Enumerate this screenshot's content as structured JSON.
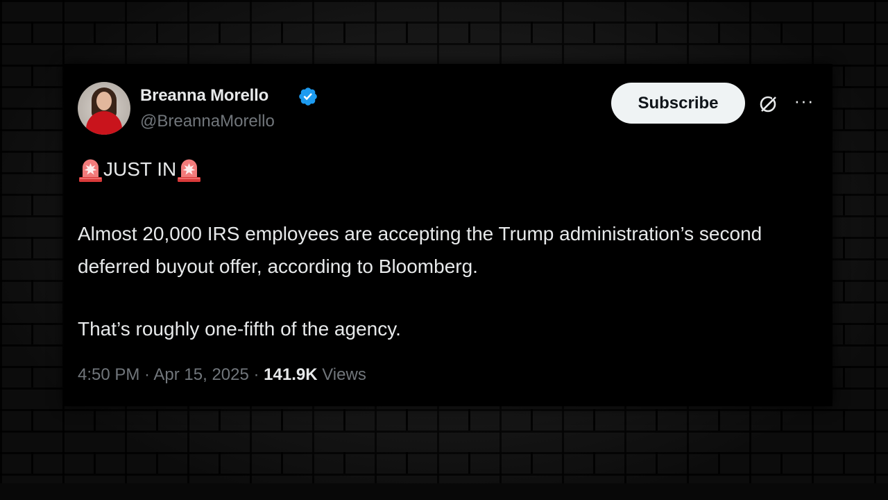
{
  "author": {
    "name": "Breanna Morello",
    "handle": "@BreannaMorello",
    "verified_color": "#1d9bf0"
  },
  "actions": {
    "subscribe_label": "Subscribe",
    "grok_icon": "grok-icon",
    "more_icon": "more-icon"
  },
  "post": {
    "headline": "JUST IN",
    "headline_icon": "police-siren-emoji",
    "paragraph_1": "Almost 20,000 IRS employees are accepting the Trump administration’s second deferred buyout offer, according to Bloomberg.",
    "paragraph_2": "That’s roughly one-fifth of the agency."
  },
  "meta": {
    "time": "4:50 PM",
    "separator": " · ",
    "date": "Apr 15, 2025",
    "views_count": "141.9K",
    "views_label": "Views"
  },
  "colors": {
    "card_background": "#000000",
    "text_primary": "#e7e9ea",
    "text_secondary": "#71767b",
    "subscribe_background": "#eff3f4"
  }
}
